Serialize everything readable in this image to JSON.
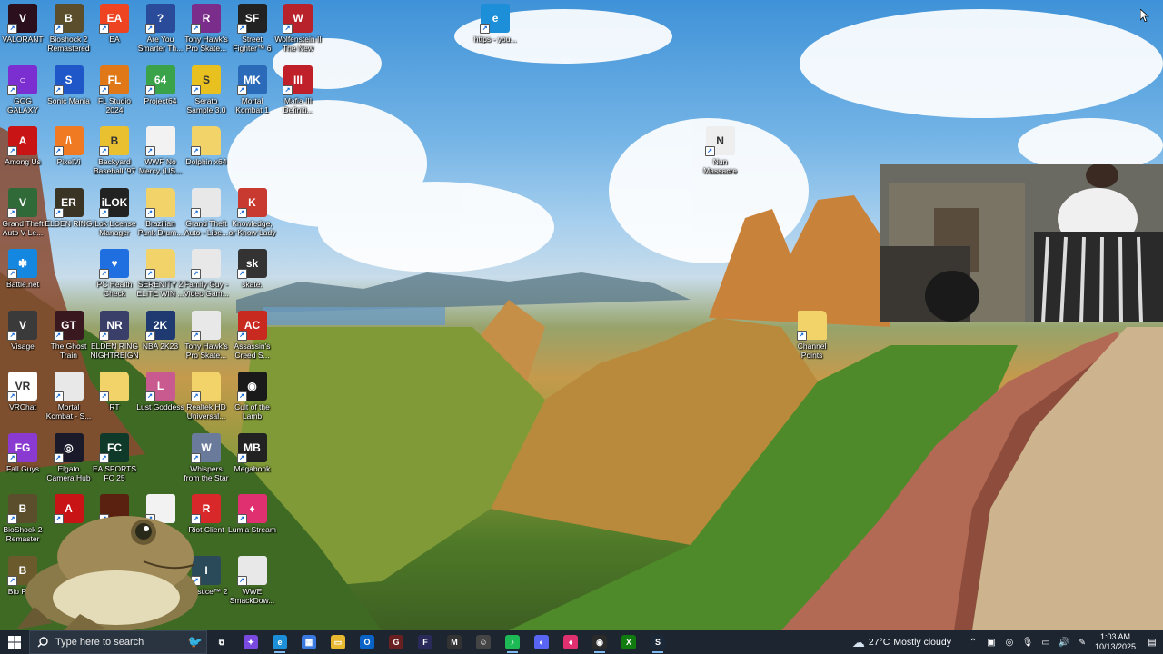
{
  "desktop_icons": [
    {
      "label": "VALORANT",
      "icon": "valorant-icon",
      "color": "#2b0f1c",
      "glyph": "V",
      "col": 0,
      "row": 0
    },
    {
      "label": "Bioshock 2 Remastered",
      "icon": "bioshock-icon",
      "color": "#5a4e2c",
      "glyph": "B",
      "col": 1,
      "row": 0
    },
    {
      "label": "EA",
      "icon": "ea-icon",
      "color": "#ee4422",
      "glyph": "EA",
      "col": 2,
      "row": 0
    },
    {
      "label": "Are You Smarter Th...",
      "icon": "game-show-icon",
      "color": "#2a4a9a",
      "glyph": "?",
      "col": 3,
      "row": 0
    },
    {
      "label": "Tony Hawk's Pro Skate...",
      "icon": "winrar-icon",
      "color": "#7a2d8a",
      "glyph": "R",
      "col": 4,
      "row": 0
    },
    {
      "label": "Street Fighter™ 6",
      "icon": "street-fighter-icon",
      "color": "#222222",
      "glyph": "SF",
      "col": 5,
      "row": 0
    },
    {
      "label": "Wolfenstein II The New Co...",
      "icon": "wolfenstein-icon",
      "color": "#b8222a",
      "glyph": "W",
      "col": 6,
      "row": 0
    },
    {
      "label": "https - you...",
      "icon": "edge-icon",
      "color": "#1d8fd8",
      "glyph": "e",
      "col": 10.3,
      "row": 0
    },
    {
      "label": "GOG GALAXY",
      "icon": "gog-galaxy-icon",
      "color": "#7b2fd0",
      "glyph": "○",
      "col": 0,
      "row": 1
    },
    {
      "label": "Sonic Mania",
      "icon": "sonic-icon",
      "color": "#1f57c8",
      "glyph": "S",
      "col": 1,
      "row": 1
    },
    {
      "label": "FL Studio 2024",
      "icon": "fl-studio-icon",
      "color": "#e07818",
      "glyph": "FL",
      "col": 2,
      "row": 1
    },
    {
      "label": "Project64",
      "icon": "project64-icon",
      "color": "#3aa34a",
      "glyph": "64",
      "col": 3,
      "row": 1
    },
    {
      "label": "Serato Sample 3.0",
      "icon": "serato-icon",
      "color": "#e8c020",
      "glyph": "S",
      "col": 4,
      "row": 1
    },
    {
      "label": "Mortal Kombat 1",
      "icon": "mortal-kombat-icon",
      "color": "#2a6ab8",
      "glyph": "MK",
      "col": 5,
      "row": 1
    },
    {
      "label": "Mafia III Definiti...",
      "icon": "mafia-icon",
      "color": "#c0202a",
      "glyph": "III",
      "col": 6,
      "row": 1
    },
    {
      "label": "Among Us",
      "icon": "among-us-icon",
      "color": "#c81414",
      "glyph": "A",
      "col": 0,
      "row": 2
    },
    {
      "label": "PixelVi",
      "icon": "pixelvi-icon",
      "color": "#f07a22",
      "glyph": "/\\",
      "col": 1,
      "row": 2
    },
    {
      "label": "Backyard Baseball '97",
      "icon": "backyard-baseball-icon",
      "color": "#e8c030",
      "glyph": "B",
      "col": 2,
      "row": 2
    },
    {
      "label": "WWF No Mercy (US...",
      "icon": "file-icon",
      "color": "#f2f2f2",
      "glyph": "",
      "col": 3,
      "row": 2
    },
    {
      "label": "Dolphin x64",
      "icon": "folder-icon",
      "color": "#f2d36a",
      "glyph": "",
      "col": 4,
      "row": 2
    },
    {
      "label": "Nun Massacre",
      "icon": "nun-massacre-icon",
      "color": "#eeeeee",
      "glyph": "N",
      "col": 15.2,
      "row": 2
    },
    {
      "label": "Grand Theft Auto V Le...",
      "icon": "gta-v-icon",
      "color": "#2f6a38",
      "glyph": "V",
      "col": 0,
      "row": 3
    },
    {
      "label": "ELDEN RING",
      "icon": "elden-ring-icon",
      "color": "#3a3424",
      "glyph": "ER",
      "col": 1,
      "row": 3
    },
    {
      "label": "iLok License Manager",
      "icon": "ilok-icon",
      "color": "#222222",
      "glyph": "iLOK",
      "col": 2,
      "row": 3
    },
    {
      "label": "Brazilian Punk Drum...",
      "icon": "folder-icon",
      "color": "#f2d36a",
      "glyph": "",
      "col": 3,
      "row": 3
    },
    {
      "label": "Grand Theft Auto - Libe...",
      "icon": "disc-icon",
      "color": "#e8e8e8",
      "glyph": "",
      "col": 4,
      "row": 3
    },
    {
      "label": "Knowledge, or Know Lady",
      "icon": "knowledge-icon",
      "color": "#c83a30",
      "glyph": "K",
      "col": 5,
      "row": 3
    },
    {
      "label": "Battle.net",
      "icon": "battlenet-icon",
      "color": "#1488e0",
      "glyph": "✱",
      "col": 0,
      "row": 4
    },
    {
      "label": "PC Health Check",
      "icon": "health-check-icon",
      "color": "#1f6fe0",
      "glyph": "♥",
      "col": 2,
      "row": 4
    },
    {
      "label": "SERENITY 2 ELITE WIN ...",
      "icon": "folder-icon",
      "color": "#f2d36a",
      "glyph": "",
      "col": 3,
      "row": 4
    },
    {
      "label": "Family Guy - Video Gam...",
      "icon": "disc-icon",
      "color": "#e8e8e8",
      "glyph": "",
      "col": 4,
      "row": 4
    },
    {
      "label": "skate.",
      "icon": "skate-icon",
      "color": "#333333",
      "glyph": "sk",
      "col": 5,
      "row": 4
    },
    {
      "label": "Visage",
      "icon": "visage-icon",
      "color": "#3a3a3a",
      "glyph": "V",
      "col": 0,
      "row": 5
    },
    {
      "label": "The Ghost Train",
      "icon": "ghost-train-icon",
      "color": "#3a1820",
      "glyph": "GT",
      "col": 1,
      "row": 5
    },
    {
      "label": "ELDEN RING NIGHTREIGN",
      "icon": "nightreign-icon",
      "color": "#3a3f6a",
      "glyph": "NR",
      "col": 2,
      "row": 5
    },
    {
      "label": "NBA 2K23",
      "icon": "nba2k-icon",
      "color": "#1f3a70",
      "glyph": "2K",
      "col": 3,
      "row": 5
    },
    {
      "label": "Tony Hawk's Pro Skate...",
      "icon": "disc-icon",
      "color": "#e8e8e8",
      "glyph": "",
      "col": 4,
      "row": 5
    },
    {
      "label": "Assassin's Creed S...",
      "icon": "assassins-creed-icon",
      "color": "#c82a20",
      "glyph": "AC",
      "col": 5,
      "row": 5
    },
    {
      "label": "Channel Points",
      "icon": "folder-icon",
      "color": "#f2d36a",
      "glyph": "",
      "col": 17.2,
      "row": 5
    },
    {
      "label": "VRChat",
      "icon": "vrchat-icon",
      "color": "#ffffff",
      "glyph": "VR",
      "col": 0,
      "row": 6
    },
    {
      "label": "Mortal Kombat - S...",
      "icon": "disc-icon",
      "color": "#e8e8e8",
      "glyph": "",
      "col": 1,
      "row": 6
    },
    {
      "label": "RT",
      "icon": "folder-icon",
      "color": "#f2d36a",
      "glyph": "",
      "col": 2,
      "row": 6
    },
    {
      "label": "Lust Goddess",
      "icon": "lust-goddess-icon",
      "color": "#c85a90",
      "glyph": "L",
      "col": 3,
      "row": 6
    },
    {
      "label": "Realtek HD Universal...",
      "icon": "folder-icon",
      "color": "#f2d36a",
      "glyph": "",
      "col": 4,
      "row": 6
    },
    {
      "label": "Cult of the Lamb",
      "icon": "cult-lamb-icon",
      "color": "#1a1a1a",
      "glyph": "◉",
      "col": 5,
      "row": 6
    },
    {
      "label": "Fall Guys",
      "icon": "fall-guys-icon",
      "color": "#8a3ad0",
      "glyph": "FG",
      "col": 0,
      "row": 7
    },
    {
      "label": "Elgato Camera Hub",
      "icon": "elgato-icon",
      "color": "#1a1a2a",
      "glyph": "◎",
      "col": 1,
      "row": 7
    },
    {
      "label": "EA SPORTS FC 25",
      "icon": "ea-fc25-icon",
      "color": "#0f3a2a",
      "glyph": "FC",
      "col": 2,
      "row": 7
    },
    {
      "label": "Whispers from the Star",
      "icon": "whispers-icon",
      "color": "#6a7a9a",
      "glyph": "W",
      "col": 4,
      "row": 7
    },
    {
      "label": "Megabonk",
      "icon": "megabonk-icon",
      "color": "#222222",
      "glyph": "MB",
      "col": 5,
      "row": 7
    },
    {
      "label": "BioShock 2 Remaster",
      "icon": "bioshock-icon",
      "color": "#5a4e2c",
      "glyph": "B",
      "col": 0,
      "row": 8
    },
    {
      "label": "",
      "icon": "among-us-icon",
      "color": "#c81414",
      "glyph": "A",
      "col": 1,
      "row": 8
    },
    {
      "label": "",
      "icon": "game-icon",
      "color": "#5a2010",
      "glyph": "",
      "col": 2,
      "row": 8
    },
    {
      "label": "",
      "icon": "file-icon",
      "color": "#f2f2f2",
      "glyph": "",
      "col": 3,
      "row": 8
    },
    {
      "label": "Riot Client",
      "icon": "riot-client-icon",
      "color": "#d8282a",
      "glyph": "R",
      "col": 4,
      "row": 8
    },
    {
      "label": "Lumia Stream",
      "icon": "lumia-stream-icon",
      "color": "#e03070",
      "glyph": "♦",
      "col": 5,
      "row": 8
    },
    {
      "label": "Bio Re...",
      "icon": "bioshock-icon",
      "color": "#6a5a2c",
      "glyph": "B",
      "col": 0,
      "row": 9
    },
    {
      "label": "Injustice™ 2",
      "icon": "injustice-icon",
      "color": "#2a4a5a",
      "glyph": "I",
      "col": 4,
      "row": 9
    },
    {
      "label": "WWE SmackDow...",
      "icon": "disc-icon",
      "color": "#e8e8e8",
      "glyph": "",
      "col": 5,
      "row": 9
    }
  ],
  "taskbar": {
    "search_placeholder": "Type here to search",
    "apps": [
      {
        "name": "task-view-icon",
        "color": "#1c2530",
        "glyph": "⧉",
        "running": false
      },
      {
        "name": "copilot-icon",
        "color": "#7a4ae0",
        "glyph": "✦",
        "running": false
      },
      {
        "name": "edge-icon",
        "color": "#1d8fd8",
        "glyph": "e",
        "running": true
      },
      {
        "name": "microsoft-store-icon",
        "color": "#3a7ae0",
        "glyph": "▦",
        "running": false
      },
      {
        "name": "file-explorer-icon",
        "color": "#e8b830",
        "glyph": "▭",
        "running": false
      },
      {
        "name": "outlook-icon",
        "color": "#0a64c8",
        "glyph": "O",
        "running": false
      },
      {
        "name": "game-icon",
        "color": "#6a2020",
        "glyph": "G",
        "running": false
      },
      {
        "name": "fatal-frame-icon",
        "color": "#2a2a5a",
        "glyph": "F",
        "running": false
      },
      {
        "name": "megabonk-icon",
        "color": "#333333",
        "glyph": "M",
        "running": false
      },
      {
        "name": "person-icon",
        "color": "#444444",
        "glyph": "☺",
        "running": false
      },
      {
        "name": "spotify-icon",
        "color": "#1db954",
        "glyph": "♪",
        "running": true
      },
      {
        "name": "discord-icon",
        "color": "#5865f2",
        "glyph": "◐",
        "running": false
      },
      {
        "name": "lumia-stream-icon",
        "color": "#e03070",
        "glyph": "♦",
        "running": false
      },
      {
        "name": "obs-icon",
        "color": "#2a2a2a",
        "glyph": "◉",
        "running": true
      },
      {
        "name": "xbox-icon",
        "color": "#107c10",
        "glyph": "X",
        "running": false
      },
      {
        "name": "steam-icon",
        "color": "#1b2838",
        "glyph": "S",
        "running": true
      }
    ],
    "weather": {
      "temp": "27°C",
      "condition": "Mostly cloudy"
    },
    "tray_icons": [
      "chevron-up-icon",
      "network-icon",
      "wifi-icon",
      "microphone-icon",
      "battery-icon",
      "speaker-icon",
      "pen-icon"
    ],
    "clock": {
      "time": "1:03 AM",
      "date": "10/13/2025"
    }
  }
}
